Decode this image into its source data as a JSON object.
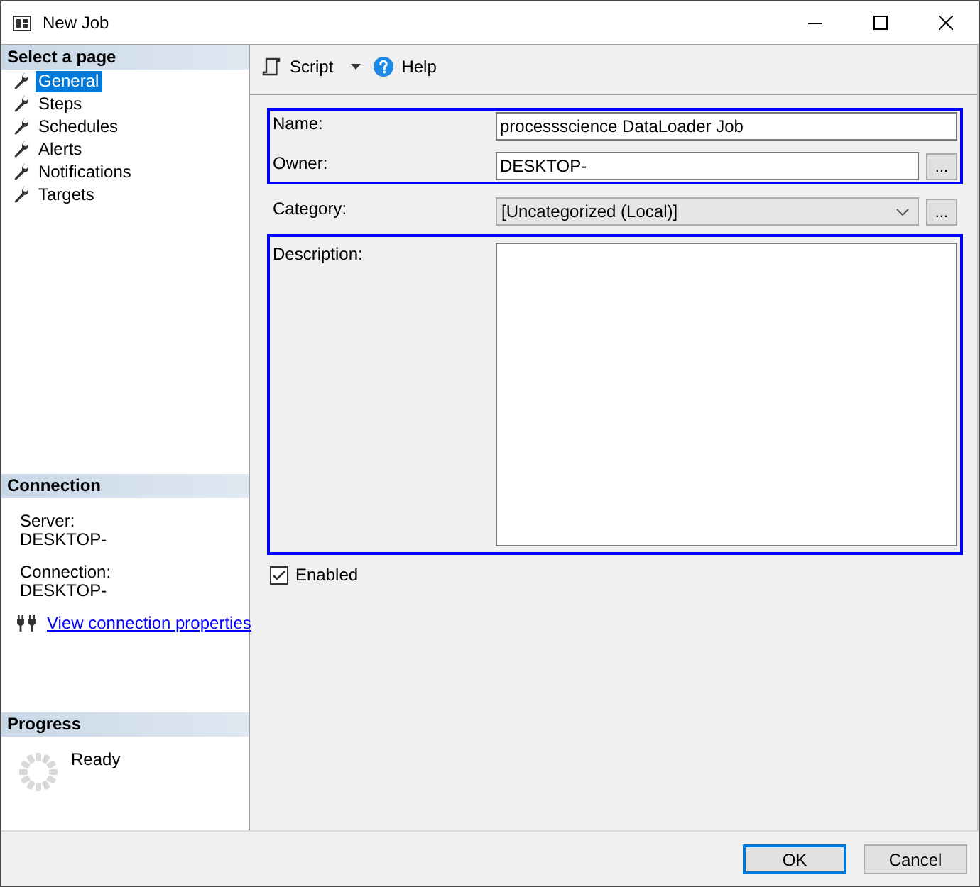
{
  "window": {
    "title": "New Job"
  },
  "sidebar": {
    "sections": [
      {
        "kind": "pages",
        "title": "Select a page",
        "items": [
          {
            "label": "General",
            "selected": true
          },
          {
            "label": "Steps",
            "selected": false
          },
          {
            "label": "Schedules",
            "selected": false
          },
          {
            "label": "Alerts",
            "selected": false
          },
          {
            "label": "Notifications",
            "selected": false
          },
          {
            "label": "Targets",
            "selected": false
          }
        ]
      },
      {
        "kind": "connection",
        "title": "Connection",
        "fields": [
          {
            "label": "Server:",
            "value": "DESKTOP-"
          },
          {
            "label": "Connection:",
            "value": "DESKTOP-"
          }
        ],
        "link": "View connection properties"
      },
      {
        "kind": "progress",
        "title": "Progress",
        "status": "Ready"
      }
    ]
  },
  "toolbar": {
    "buttons": [
      {
        "kind": "script",
        "label": "Script",
        "dropdown": true
      },
      {
        "kind": "help",
        "label": "Help",
        "dropdown": false
      }
    ]
  },
  "form": {
    "groups": [
      {
        "highlighted": true,
        "fields": [
          {
            "kind": "text",
            "label": "Name:",
            "value": "processscience DataLoader Job"
          },
          {
            "kind": "text",
            "label": "Owner:",
            "value": "DESKTOP-",
            "button": "..."
          }
        ]
      },
      {
        "highlighted": false,
        "fields": [
          {
            "kind": "select",
            "label": "Category:",
            "value": "[Uncategorized (Local)]",
            "button": "..."
          }
        ]
      },
      {
        "highlighted": true,
        "fields": [
          {
            "kind": "textarea",
            "label": "Description:"
          }
        ]
      }
    ],
    "enabled": {
      "label": "Enabled",
      "checked": true
    }
  },
  "footer": {
    "buttons": [
      {
        "label": "OK",
        "default": true
      },
      {
        "label": "Cancel",
        "default": false
      }
    ]
  }
}
